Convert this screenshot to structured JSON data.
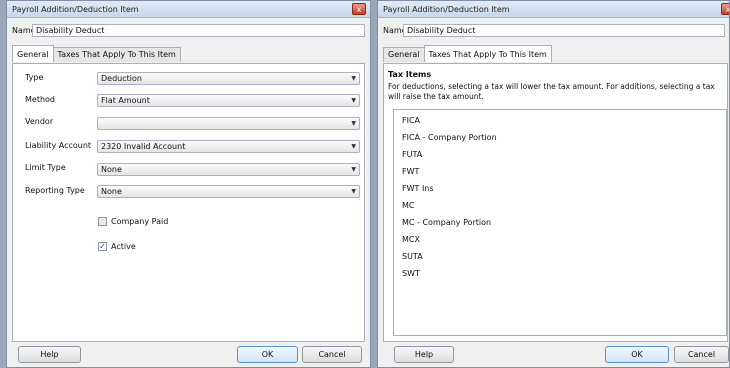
{
  "window_title": "Payroll Addition/Deduction Item",
  "name_label": "Name",
  "name_value": "Disability Deduct",
  "tabs": [
    "General",
    "Taxes That Apply To This Item"
  ],
  "general": {
    "fields": [
      {
        "label": "Type",
        "value": "Deduction"
      },
      {
        "label": "Method",
        "value": "Flat Amount"
      },
      {
        "label": "Vendor",
        "value": ""
      },
      {
        "label": "Liability Account",
        "value": "2320 Invalid Account"
      },
      {
        "label": "Limit Type",
        "value": "None"
      },
      {
        "label": "Reporting Type",
        "value": "None"
      }
    ],
    "company_paid": {
      "label": "Company Paid",
      "checked": false
    },
    "active": {
      "label": "Active",
      "checked": true
    }
  },
  "taxes": {
    "heading": "Tax Items",
    "description": "For deductions, selecting a tax will lower the tax amount.  For additions, selecting a tax will raise the tax amount.",
    "items": [
      "FICA",
      "FICA - Company Portion",
      "FUTA",
      "FWT",
      "FWT Ins",
      "MC",
      "MC - Company Portion",
      "MCX",
      "SUTA",
      "SWT"
    ]
  },
  "buttons": {
    "help": "Help",
    "ok": "OK",
    "cancel": "Cancel"
  },
  "close_glyph": "x",
  "check_glyph": "✓",
  "dropdown_glyph": "▼"
}
